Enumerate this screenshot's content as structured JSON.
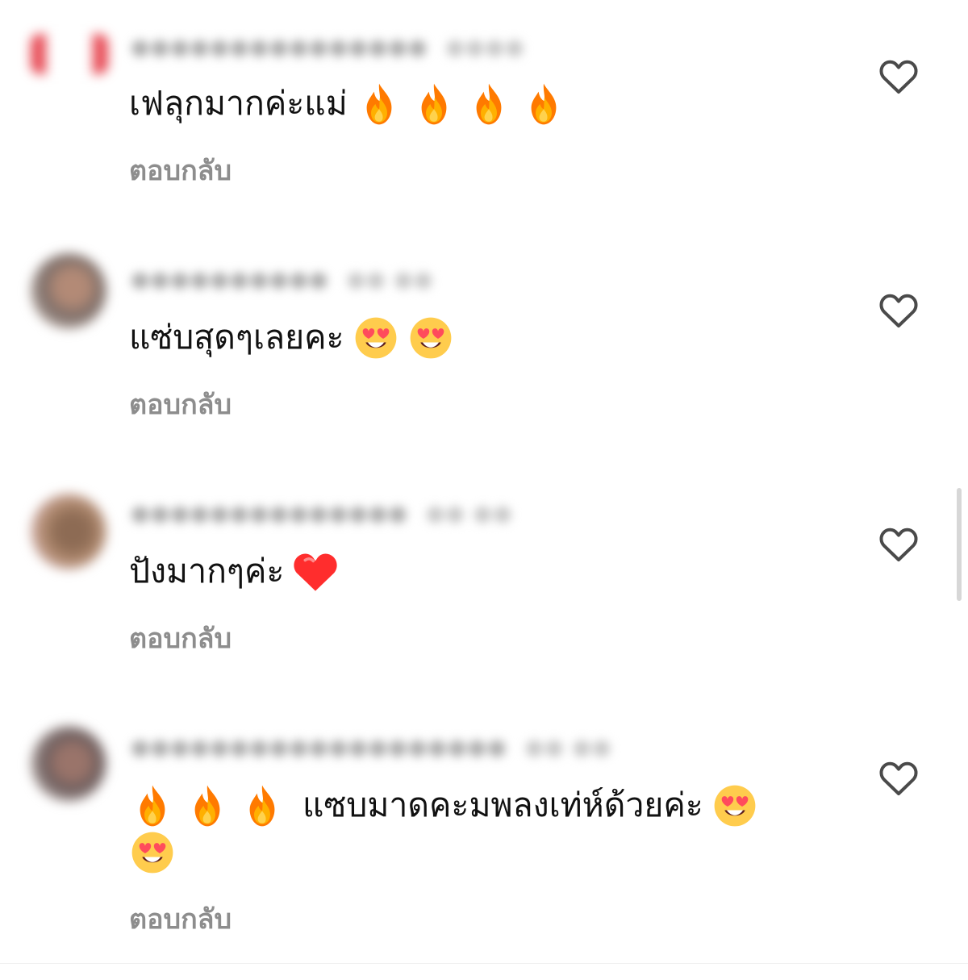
{
  "comments": [
    {
      "text": "เฟลุกมากค่ะแม่",
      "emojis_after": [
        "fire-emoji",
        "fire-emoji",
        "fire-emoji",
        "fire-emoji"
      ],
      "reply_label": "ตอบกลับ",
      "heart_icon": "heart-outline-icon"
    },
    {
      "text": "แซ่บสุดๆเลยคะ",
      "emojis_after": [
        "heart-eyes-emoji",
        "heart-eyes-emoji"
      ],
      "reply_label": "ตอบกลับ",
      "heart_icon": "heart-outline-icon"
    },
    {
      "text": "ปังมากๆค่ะ",
      "emojis_after": [
        "red-heart-emoji"
      ],
      "reply_label": "ตอบกลับ",
      "heart_icon": "heart-outline-icon"
    },
    {
      "text": "แซบมาดคะมพลงเท่ห์ด้วยค่ะ",
      "emojis_before": [
        "fire-emoji",
        "fire-emoji",
        "fire-emoji"
      ],
      "emojis_after": [
        "heart-eyes-emoji"
      ],
      "emojis_next_line": [
        "heart-eyes-emoji"
      ],
      "reply_label": "ตอบกลับ",
      "heart_icon": "heart-outline-icon"
    }
  ],
  "colors": {
    "text": "#111111",
    "reply": "#8d8d8d",
    "heart_outline": "#4a4a4a",
    "scrollbar": "#d7d7d7"
  }
}
